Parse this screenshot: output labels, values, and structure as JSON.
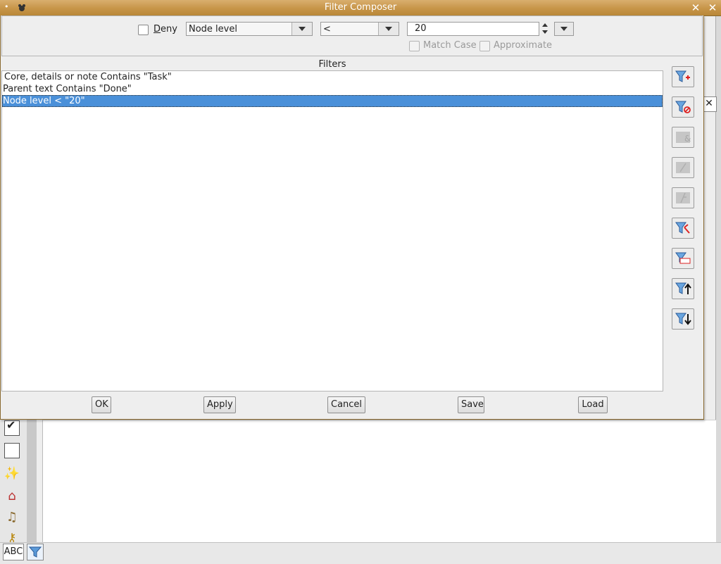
{
  "window": {
    "title": "Filter Composer",
    "menu_glyph": "•"
  },
  "controls": {
    "deny_label": "Deny",
    "deny_checked": false,
    "property_value": "Node level",
    "operator_value": "<",
    "value_text": "20",
    "match_case_label": "Match Case",
    "approximate_label": "Approximate"
  },
  "filters": {
    "heading": "Filters",
    "items": [
      {
        "text": "Core, details or note Contains \"Task\"",
        "selected": false
      },
      {
        "text": "Parent text Contains \"Done\"",
        "selected": false
      },
      {
        "text": "Node level < \"20\"",
        "selected": true
      }
    ]
  },
  "side_buttons": [
    {
      "name": "add-filter-button",
      "icon": "filter-add-icon",
      "enabled": true
    },
    {
      "name": "negate-filter-button",
      "icon": "filter-not-icon",
      "enabled": true
    },
    {
      "name": "and-filter-button",
      "icon": "filter-and-icon",
      "enabled": false
    },
    {
      "name": "or-filter-button",
      "icon": "filter-or-icon",
      "enabled": false
    },
    {
      "name": "split-filter-button",
      "icon": "filter-split-icon",
      "enabled": false
    },
    {
      "name": "delete-filter-button",
      "icon": "filter-delete-icon",
      "enabled": true
    },
    {
      "name": "rename-filter-button",
      "icon": "filter-rename-icon",
      "enabled": true
    },
    {
      "name": "move-up-filter-button",
      "icon": "filter-up-icon",
      "enabled": true
    },
    {
      "name": "move-down-filter-button",
      "icon": "filter-down-icon",
      "enabled": true
    }
  ],
  "buttons": {
    "ok": "OK",
    "apply": "Apply",
    "cancel": "Cancel",
    "save": "Save",
    "load": "Load"
  },
  "background": {
    "status_abc": "ABC",
    "close_glyph": "✕"
  },
  "colors": {
    "titlebar": "#c79548",
    "selection": "#4a90d9"
  }
}
